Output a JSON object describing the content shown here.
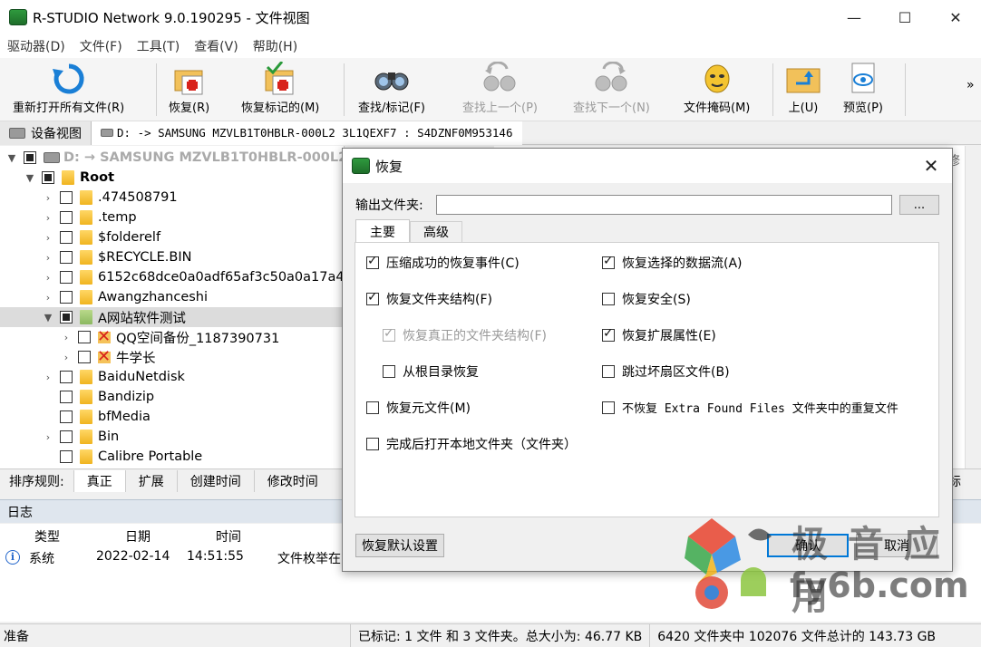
{
  "window": {
    "title": "R-STUDIO Network 9.0.190295 - 文件视图",
    "minimize": "—",
    "maximize": "☐",
    "close": "✕"
  },
  "menu": [
    "驱动器(D)",
    "文件(F)",
    "工具(T)",
    "查看(V)",
    "帮助(H)"
  ],
  "toolbar": {
    "reopen": "重新打开所有文件(R)",
    "recover": "恢复(R)",
    "recover_marked": "恢复标记的(M)",
    "find_mark": "查找/标记(F)",
    "find_prev": "查找上一个(P)",
    "find_next": "查找下一个(N)",
    "file_mask": "文件掩码(M)",
    "up": "上(U)",
    "preview": "预览(P)",
    "overflow": "»"
  },
  "tabs": {
    "devices": "设备视图",
    "path": "D: -> SAMSUNG MZVLB1T0HBLR-000L2 3L1QEXF7 : S4DZNF0M953146"
  },
  "tree": {
    "drive": "D: → SAMSUNG MZVLB1T0HBLR-000L2 3",
    "root": "Root",
    "items": [
      ".474508791",
      ".temp",
      "$folderelf",
      "$RECYCLE.BIN",
      "6152c68dce0a0adf65af3c50a0a17a47",
      "Awangzhanceshi",
      "A网站软件测试",
      "QQ空间备份_1187390731",
      "牛学长",
      "BaiduNetdisk",
      "Bandizip",
      "bfMedia",
      "Bin",
      "Calibre Portable"
    ]
  },
  "right_panel": {
    "header_fragment": "修",
    "tab_fragment": "标"
  },
  "sort": {
    "label": "排序规则:",
    "tabs": [
      "真正",
      "扩展",
      "创建时间",
      "修改时间"
    ]
  },
  "log": {
    "title": "日志",
    "headers": [
      "类型",
      "日期",
      "时间"
    ],
    "row": {
      "type": "系统",
      "date": "2022-02-14",
      "time": "14:51:55",
      "message": "文件枚举在"
    }
  },
  "status": {
    "ready": "准备",
    "marked": "已标记: 1 文件 和 3 文件夹。总大小为: 46.77 KB",
    "total": "6420 文件夹中 102076 文件总计的 143.73 GB"
  },
  "dialog": {
    "title": "恢复",
    "output_label": "输出文件夹:",
    "output_value": "",
    "browse": "...",
    "tabs": [
      "主要",
      "高级"
    ],
    "options_left": [
      {
        "label": "压缩成功的恢复事件(C)",
        "checked": true,
        "disabled": false
      },
      {
        "label": "恢复文件夹结构(F)",
        "checked": true,
        "disabled": false
      },
      {
        "label": "恢复真正的文件夹结构(F)",
        "checked": true,
        "disabled": true
      },
      {
        "label": "从根目录恢复",
        "checked": false,
        "disabled": false
      },
      {
        "label": "恢复元文件(M)",
        "checked": false,
        "disabled": false
      },
      {
        "label": "完成后打开本地文件夹（文件夹）",
        "checked": false,
        "disabled": false
      }
    ],
    "options_right": [
      {
        "label": "恢复选择的数据流(A)",
        "checked": true
      },
      {
        "label": "恢复安全(S)",
        "checked": false
      },
      {
        "label": "恢复扩展属性(E)",
        "checked": true
      },
      {
        "label": "跳过坏扇区文件(B)",
        "checked": false
      },
      {
        "label": "不恢复 Extra Found Files 文件夹中的重复文件",
        "checked": false
      }
    ],
    "reset_button": "恢复默认设置",
    "ok_button": "确认",
    "cancel_button": "取消"
  },
  "watermark": {
    "top": "极 音 应 用",
    "bottom": "fy6b.com"
  },
  "colors": {
    "accent": "#0078d7",
    "folder": "#f0b420",
    "log_bar": "#dfe6ee"
  }
}
